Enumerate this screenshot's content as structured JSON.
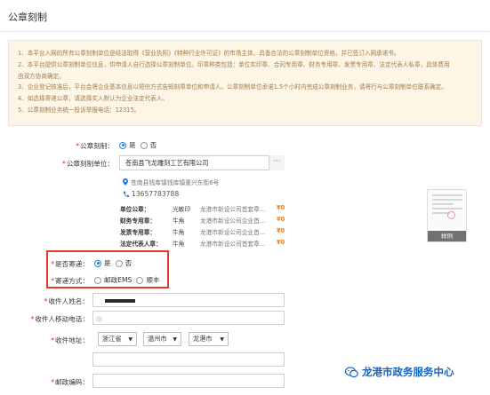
{
  "page": {
    "title": "公章刻制"
  },
  "notice": {
    "lines": [
      "1、本平台入网的所有公章刻制单位是经法取得《营业执照》《特种行业许可证》的市场主体，具备合法的公章刻制单位资格，并已签订入网承诺书。",
      "2、本平台提供公章刻制单位信息，供申请人自行选择公章刻制单位。印章种类包括：单位实印章、合同专用章、财务专用章、发票专用章、法定代表人私章，具体费用",
      "由双方协商确定。",
      "3、企业登记核准后，平台会将企业基本信息以短信方式告知刻章单位和申请人。公章刻制单位承诺1.5个小时内完成公章刻制业务，请将行与公章刻制单位联系确定。",
      "4、如选择寄递公章，请选择实人默认为企业法定代表人。",
      "5、公章刻制业务统一投诉举报电话：12315。"
    ]
  },
  "form": {
    "engrave": {
      "label": "公章刻制：",
      "options": [
        "是",
        "否"
      ],
      "selected": "是"
    },
    "unit": {
      "label": "公章刻制单位：",
      "value": "苍南县飞龙雕刻工艺有限公司",
      "more_label": "···",
      "address": "苍南县钱库镇钱库镇重兴东街6号",
      "phone": "13657783788",
      "seals": [
        {
          "name": "单位公章：",
          "material": "光敏印",
          "company": "龙港市新设公司首套章...",
          "price": "¥0"
        },
        {
          "name": "财务专用章：",
          "material": "牛角",
          "company": "龙港市新设公司企业首...",
          "price": "¥0"
        },
        {
          "name": "发票专用章：",
          "material": "牛角",
          "company": "龙港市新设公司企业首...",
          "price": "¥0"
        },
        {
          "name": "法定代表人章：",
          "material": "牛角",
          "company": "龙港市新设公司首套章...",
          "price": "¥0"
        }
      ],
      "sample_label": "样例"
    },
    "mail": {
      "label": "是否寄递：",
      "options": [
        "是",
        "否"
      ],
      "selected": "是"
    },
    "mail_method": {
      "label": "寄递方式：",
      "options": [
        "邮政EMS",
        "顺丰"
      ],
      "selected": ""
    },
    "recipient_name": {
      "label": "收件人姓名：",
      "value": ""
    },
    "recipient_phone": {
      "label": "收件人移动电话：",
      "value": ""
    },
    "address": {
      "label": "收件地址：",
      "province": "浙江省",
      "city": "温州市",
      "district": "龙港市",
      "detail": ""
    },
    "postcode": {
      "label": "邮政编码：",
      "value": ""
    }
  },
  "watermark": {
    "text": "龙港市政务服务中心"
  },
  "colors": {
    "accent": "#1e7ee4",
    "highlight": "#e53e2a",
    "required": "#e02020",
    "price": "#e67e22"
  }
}
